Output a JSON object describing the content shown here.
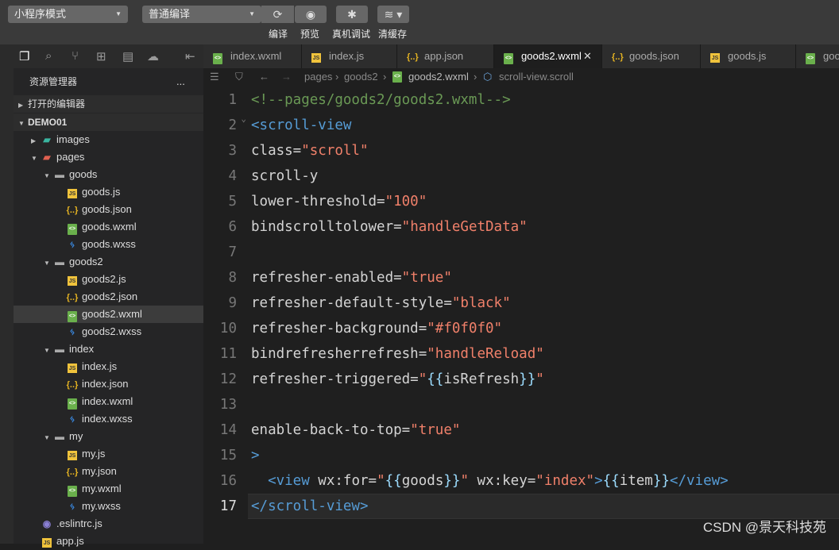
{
  "toolbar": {
    "mode": "小程序模式",
    "compile_mode": "普通编译",
    "labels": {
      "compile": "编译",
      "preview": "预览",
      "debug": "真机调试",
      "clear_cache": "清缓存"
    }
  },
  "tabs": [
    {
      "label": "index.wxml",
      "type": "wxml"
    },
    {
      "label": "index.js",
      "type": "js"
    },
    {
      "label": "app.json",
      "type": "json"
    },
    {
      "label": "goods2.wxml",
      "type": "wxml",
      "active": true
    },
    {
      "label": "goods.json",
      "type": "json"
    },
    {
      "label": "goods.js",
      "type": "js"
    },
    {
      "label": "goods.wxml",
      "type": "wxml"
    }
  ],
  "sidebar": {
    "title": "资源管理器",
    "more": "...",
    "open_editors": "打开的编辑器",
    "project": "DEMO01",
    "tree": [
      {
        "label": "images",
        "type": "folder-img",
        "depth": 1,
        "arrow": "▶"
      },
      {
        "label": "pages",
        "type": "folder-pages",
        "depth": 1,
        "arrow": "▼"
      },
      {
        "label": "goods",
        "type": "folder",
        "depth": 2,
        "arrow": "▼"
      },
      {
        "label": "goods.js",
        "type": "js",
        "depth": 3
      },
      {
        "label": "goods.json",
        "type": "json",
        "depth": 3
      },
      {
        "label": "goods.wxml",
        "type": "wxml",
        "depth": 3
      },
      {
        "label": "goods.wxss",
        "type": "wxss",
        "depth": 3
      },
      {
        "label": "goods2",
        "type": "folder",
        "depth": 2,
        "arrow": "▼"
      },
      {
        "label": "goods2.js",
        "type": "js",
        "depth": 3
      },
      {
        "label": "goods2.json",
        "type": "json",
        "depth": 3
      },
      {
        "label": "goods2.wxml",
        "type": "wxml",
        "depth": 3,
        "selected": true
      },
      {
        "label": "goods2.wxss",
        "type": "wxss",
        "depth": 3
      },
      {
        "label": "index",
        "type": "folder",
        "depth": 2,
        "arrow": "▼"
      },
      {
        "label": "index.js",
        "type": "js",
        "depth": 3
      },
      {
        "label": "index.json",
        "type": "json",
        "depth": 3
      },
      {
        "label": "index.wxml",
        "type": "wxml",
        "depth": 3
      },
      {
        "label": "index.wxss",
        "type": "wxss",
        "depth": 3
      },
      {
        "label": "my",
        "type": "folder",
        "depth": 2,
        "arrow": "▼"
      },
      {
        "label": "my.js",
        "type": "js",
        "depth": 3
      },
      {
        "label": "my.json",
        "type": "json",
        "depth": 3
      },
      {
        "label": "my.wxml",
        "type": "wxml",
        "depth": 3
      },
      {
        "label": "my.wxss",
        "type": "wxss",
        "depth": 3
      },
      {
        "label": ".eslintrc.js",
        "type": "eslint",
        "depth": 1
      },
      {
        "label": "app.js",
        "type": "js",
        "depth": 1
      }
    ]
  },
  "breadcrumb": [
    "pages",
    "goods2",
    "goods2.wxml",
    "scroll-view.scroll"
  ],
  "editor": {
    "current_line": 17,
    "lines": [
      [
        [
          "<!--pages/goods2/goods2.wxml-->",
          "comment"
        ]
      ],
      [
        [
          "<scroll-view",
          "tag"
        ]
      ],
      [
        [
          "class=",
          "attr"
        ],
        [
          "\"scroll\"",
          "str"
        ]
      ],
      [
        [
          "scroll-y",
          "attr"
        ]
      ],
      [
        [
          "lower-threshold=",
          "attr"
        ],
        [
          "\"100\"",
          "str"
        ]
      ],
      [
        [
          "bindscrolltolower=",
          "attr"
        ],
        [
          "\"handleGetData\"",
          "str"
        ]
      ],
      [],
      [
        [
          "refresher-enabled=",
          "attr"
        ],
        [
          "\"true\"",
          "str"
        ]
      ],
      [
        [
          "refresher-default-style=",
          "attr"
        ],
        [
          "\"black\"",
          "str"
        ]
      ],
      [
        [
          "refresher-background=",
          "attr"
        ],
        [
          "\"#f0f0f0\"",
          "str"
        ]
      ],
      [
        [
          "bindrefresherrefresh=",
          "attr"
        ],
        [
          "\"handleReload\"",
          "str"
        ]
      ],
      [
        [
          "refresher-triggered=",
          "attr"
        ],
        [
          "\"",
          "str"
        ],
        [
          "{{",
          "brace"
        ],
        [
          "isRefresh",
          "text"
        ],
        [
          "}}",
          "brace"
        ],
        [
          "\"",
          "str"
        ]
      ],
      [],
      [
        [
          "enable-back-to-top=",
          "attr"
        ],
        [
          "\"true\"",
          "str"
        ]
      ],
      [
        [
          ">",
          "tag"
        ]
      ],
      [
        [
          "  ",
          "text"
        ],
        [
          "<view ",
          "tag"
        ],
        [
          "wx:for=",
          "attr"
        ],
        [
          "\"",
          "str"
        ],
        [
          "{{",
          "brace"
        ],
        [
          "goods",
          "text"
        ],
        [
          "}}",
          "brace"
        ],
        [
          "\"",
          "str"
        ],
        [
          " wx:key=",
          "attr"
        ],
        [
          "\"index\"",
          "str"
        ],
        [
          ">",
          "tag"
        ],
        [
          "{{",
          "brace"
        ],
        [
          "item",
          "text"
        ],
        [
          "}}",
          "brace"
        ],
        [
          "</view>",
          "tag"
        ]
      ],
      [
        [
          "</scroll-view>",
          "tag"
        ]
      ]
    ]
  },
  "watermark": "CSDN @景天科技苑"
}
